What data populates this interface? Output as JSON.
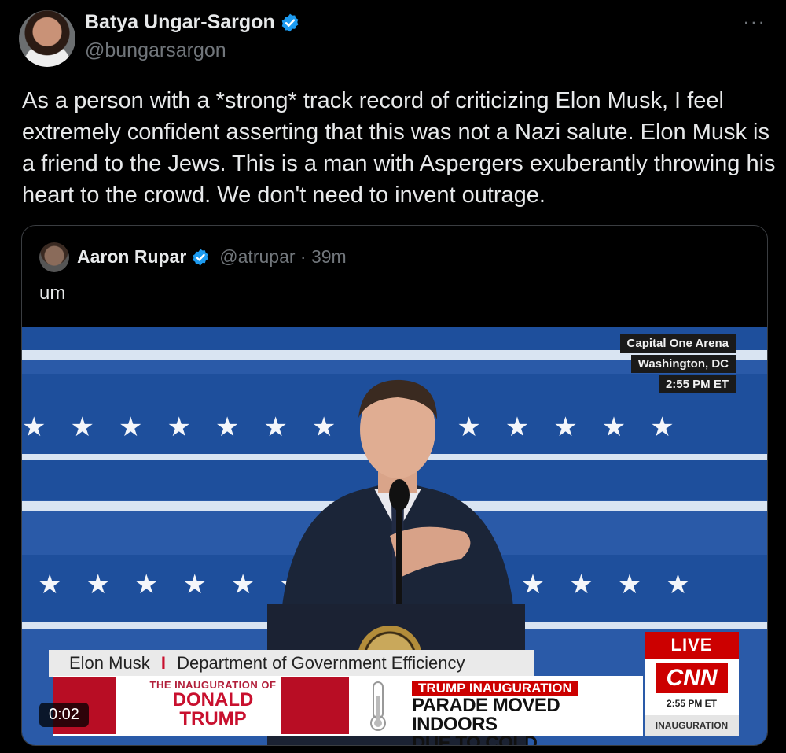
{
  "author": {
    "name": "Batya Ungar-Sargon",
    "handle": "@bungarsargon",
    "more_icon": "···",
    "verified_color": "#1d9bf0"
  },
  "tweet": {
    "text": "As a person with a *strong* track record of criticizing Elon Musk, I feel extremely confident asserting that this was not a Nazi salute. Elon Musk is a friend to the Jews. This is a man with Aspergers exuberantly throwing his heart to the crowd. We don't need to invent outrage."
  },
  "quote": {
    "name": "Aaron Rupar",
    "handle": "@atrupar · 39m",
    "text": "um"
  },
  "video": {
    "location_tag": "Capital One Arena",
    "city_tag": "Washington, DC",
    "time_tag": "2:55 PM ET",
    "lower_third_name": "Elon Musk",
    "lower_third_sep": "I",
    "lower_third_title": "Department of Government Efficiency",
    "inaug_small": "THE INAUGURATION OF",
    "inaug_line1": "DONALD",
    "inaug_line2": "TRUMP",
    "headline_tag": "TRUMP INAUGURATION",
    "headline_line1": "PARADE MOVED INDOORS",
    "headline_line2": "DUE TO COLD",
    "live_label": "LIVE",
    "network": "CNN",
    "network_time": "2:55 PM ET",
    "network_label": "INAUGURATION",
    "duration": "0:02",
    "stars_row": "★★★★★★★★★★★★★★"
  }
}
